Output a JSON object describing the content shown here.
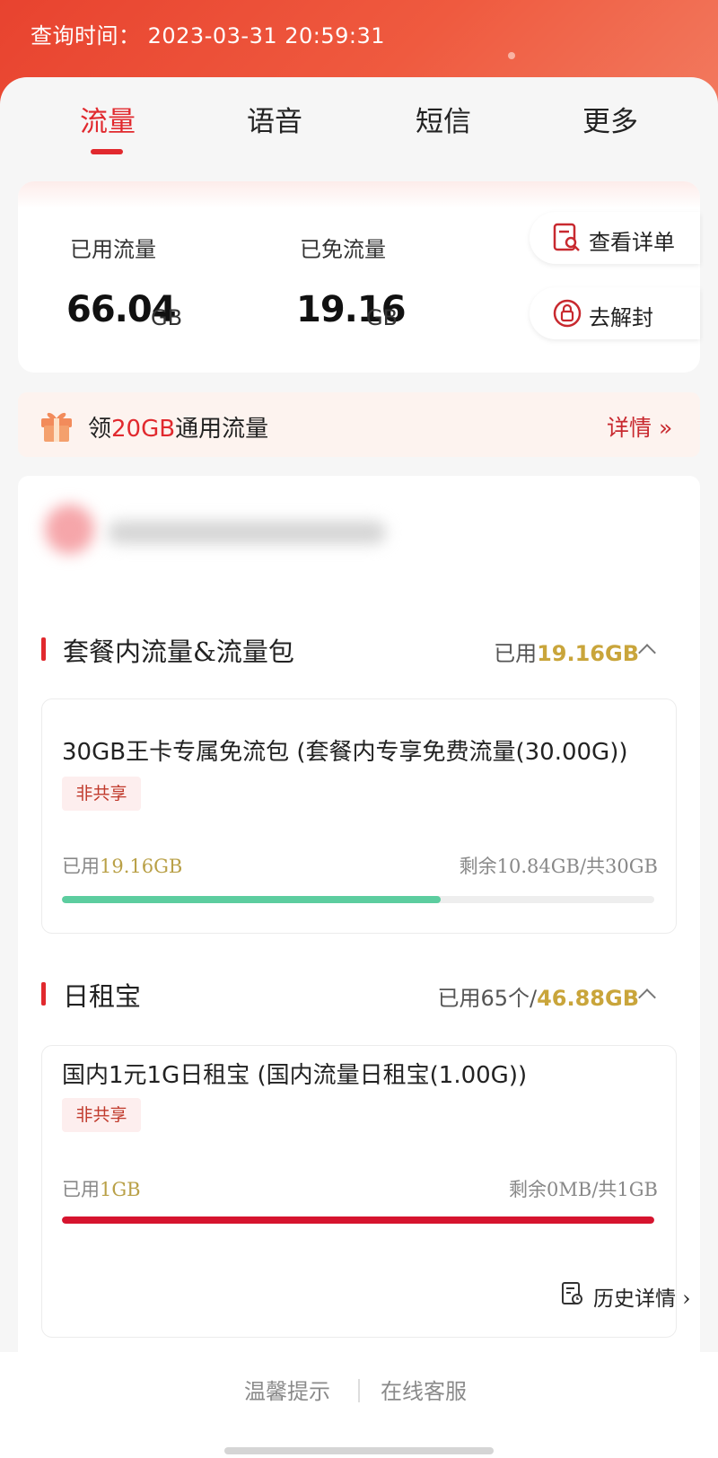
{
  "header": {
    "query_time": "查询时间： 2023-03-31 20:59:31"
  },
  "tabs": [
    {
      "label": "流量",
      "active": true
    },
    {
      "label": "语音",
      "active": false
    },
    {
      "label": "短信",
      "active": false
    },
    {
      "label": "更多",
      "active": false
    }
  ],
  "summary": {
    "used": {
      "label": "已用流量",
      "value": "66.04",
      "unit": "GB"
    },
    "free": {
      "label": "已免流量",
      "value": "19.16",
      "unit": "GB"
    },
    "view_details": "查看详单",
    "unblock": "去解封"
  },
  "promo": {
    "prefix": "领",
    "highlight": "20GB",
    "suffix": "通用流量",
    "detail": "详情 »"
  },
  "sections": [
    {
      "title": "套餐内流量&流量包",
      "used_prefix": "已用",
      "used_value": "19.16GB",
      "package": {
        "name": "30GB王卡专属免流包 (套餐内专享免费流量(30.00G))",
        "tag": "非共享",
        "used_label": "已用",
        "used_value": "19.16GB",
        "remaining": "剩余10.84GB/共30GB",
        "progress": 0.64,
        "bar_color": "#5ccd9f"
      }
    },
    {
      "title": "日租宝",
      "used_prefix": "已用65个/",
      "used_value": "46.88GB",
      "package": {
        "name": "国内1元1G日租宝 (国内流量日租宝(1.00G))",
        "tag": "非共享",
        "used_label": "已用",
        "used_value": "1GB",
        "remaining": "剩余0MB/共1GB",
        "progress": 1.0,
        "bar_color": "#d6142e",
        "history": "历史详情 ›"
      }
    }
  ],
  "footer": {
    "tips": "温馨提示",
    "service": "在线客服"
  },
  "colors": {
    "accent": "#e1292e",
    "header": "#e8432f",
    "gold": "#c9a53b"
  }
}
